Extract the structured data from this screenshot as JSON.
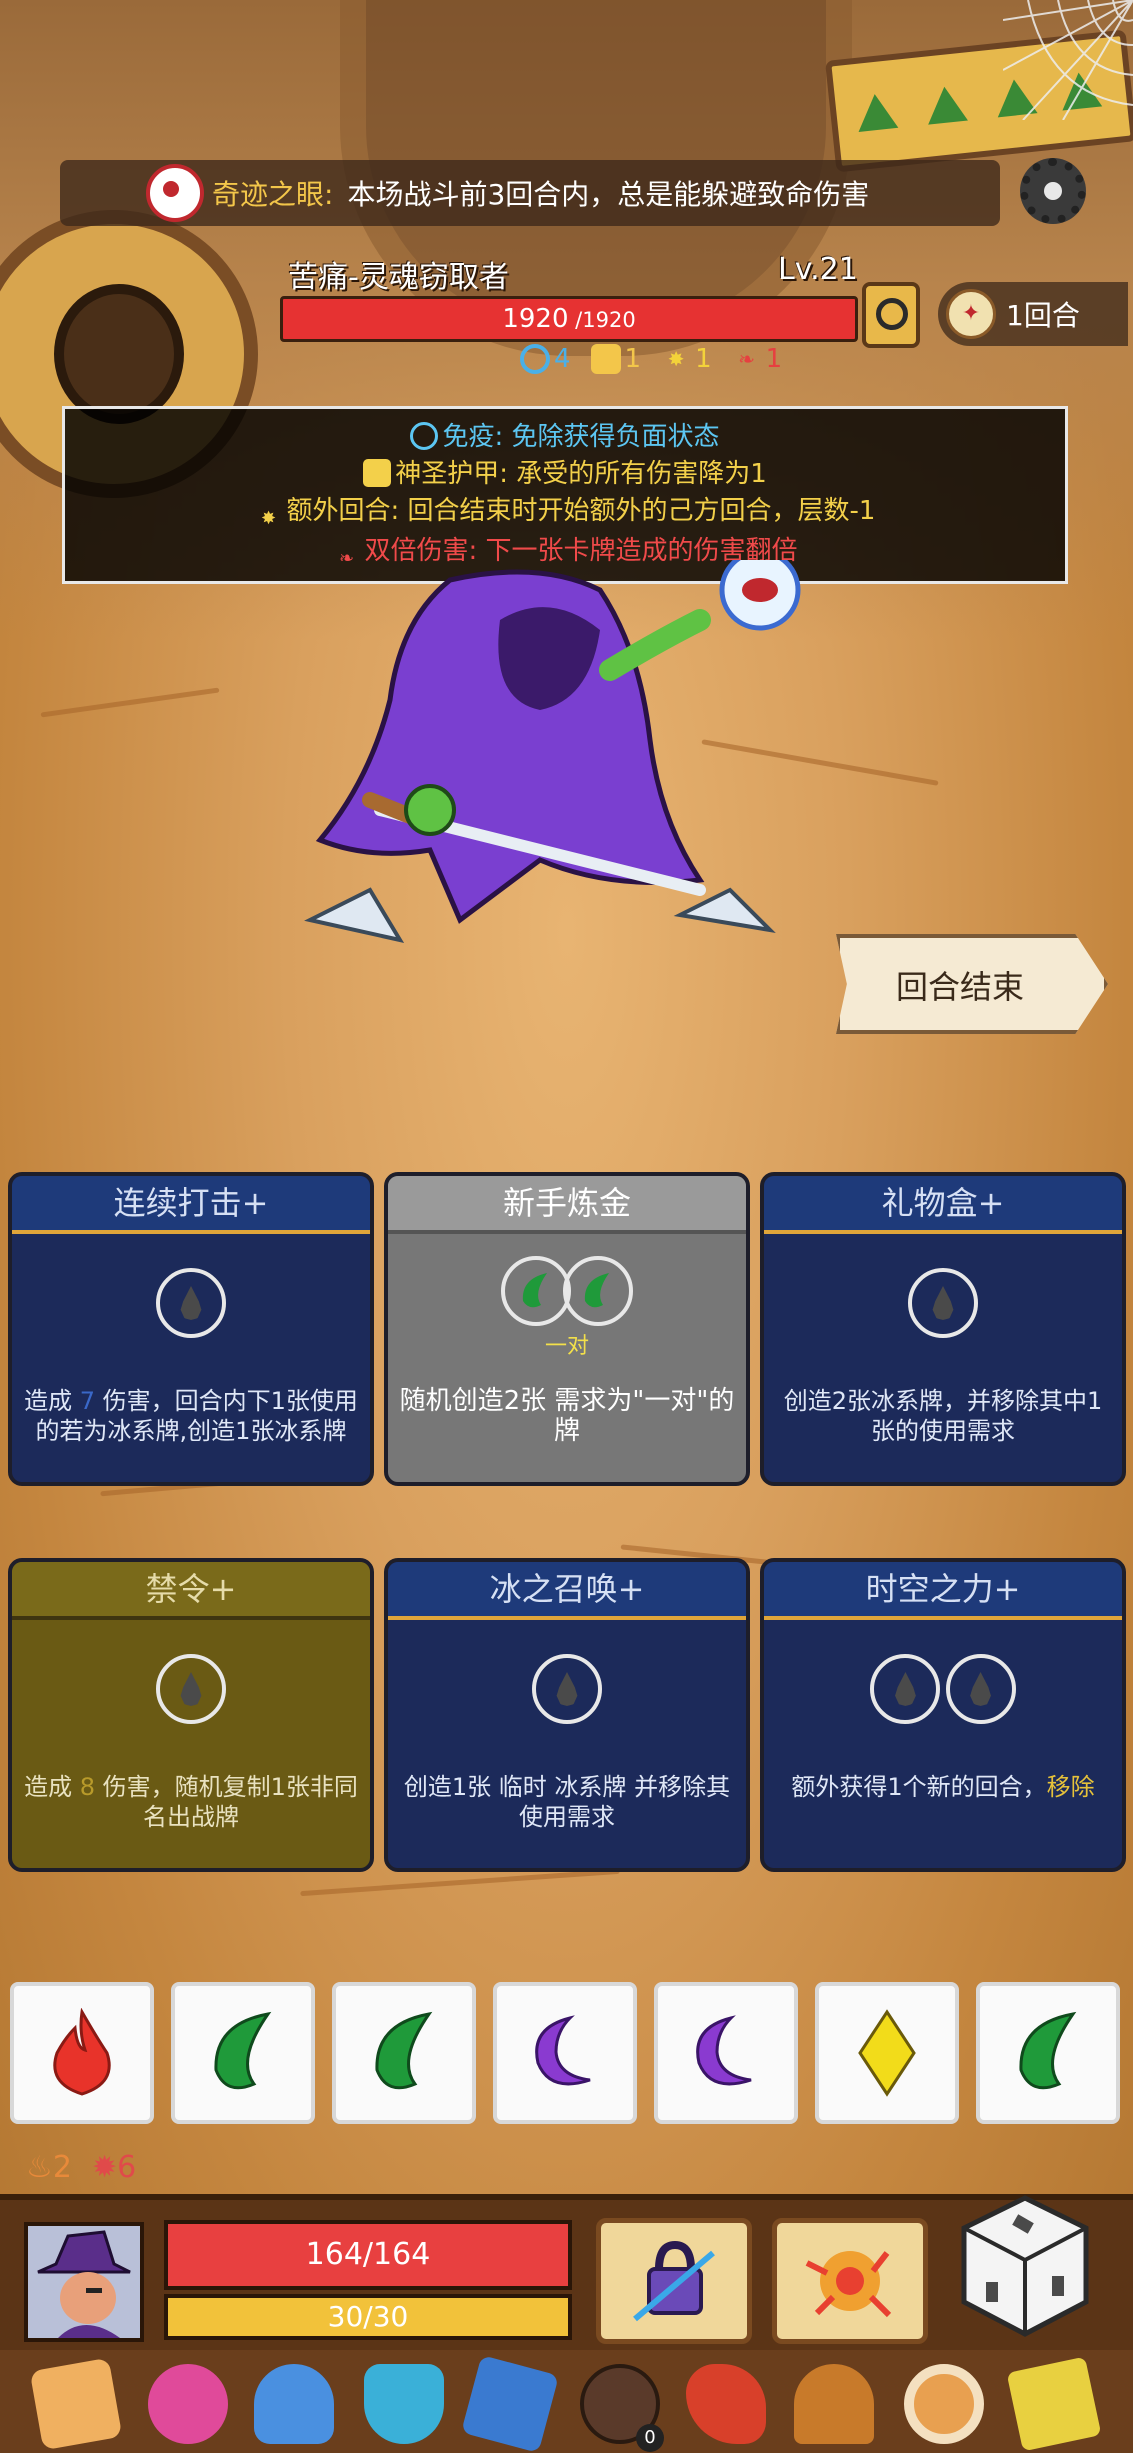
{
  "relic_banner": {
    "name": "奇迹之眼:",
    "description": "本场战斗前3回合内，总是能躲避致命伤害"
  },
  "enemy": {
    "name": "苦痛-灵魂窃取者",
    "level": "Lv.21",
    "hp_current": "1920",
    "hp_max": " /1920",
    "hp_fraction": 1.0,
    "turn_counter": "1回合",
    "statuses": [
      {
        "icon": "immunity-icon",
        "count": "4",
        "color": "#4ab0e8"
      },
      {
        "icon": "holy-armor-icon",
        "count": "1",
        "color": "#f3c64a"
      },
      {
        "icon": "extra-turn-icon",
        "count": "1",
        "color": "#f3d23a"
      },
      {
        "icon": "double-damage-icon",
        "count": "1",
        "color": "#e64040"
      }
    ]
  },
  "status_panel": [
    {
      "text": "免疫: 免除获得负面状态",
      "color": "#5cc6f2",
      "icon": "immunity-icon"
    },
    {
      "text": "神圣护甲: 承受的所有伤害降为1",
      "color": "#f3d04a",
      "icon": "holy-armor-icon"
    },
    {
      "text": "额外回合: 回合结束时开始额外的己方回合，层数-1",
      "color": "#f3d04a",
      "icon": "extra-turn-icon"
    },
    {
      "text": "双倍伤害: 下一张卡牌造成的伤害翻倍",
      "color": "#f04a4a",
      "icon": "double-damage-icon"
    }
  ],
  "end_turn_label": "回合结束",
  "cards": [
    {
      "title": "连续打击+",
      "style": "blue",
      "slots": 1,
      "desc_parts": [
        "造成 ",
        "7",
        " 伤害，回合内下1张使用的若为",
        "冰系牌,",
        "创造1张冰系牌"
      ]
    },
    {
      "title": "新手炼金",
      "style": "gray",
      "pair_label": "一对",
      "desc": "随机创造2张 需求为\"一对\"的牌"
    },
    {
      "title": "礼物盒+",
      "style": "blue",
      "slots": 1,
      "desc": "创造2张冰系牌，并移除其中1张的使用需求"
    },
    {
      "title": "禁令+",
      "style": "olive",
      "slots": 1,
      "desc_parts": [
        "造成 ",
        "8",
        " 伤害，随机复制1张非同名出战牌"
      ]
    },
    {
      "title": "冰之召唤+",
      "style": "blue",
      "slots": 1,
      "desc_parts": [
        "创造1张 临时 ",
        "冰系牌 并移除其使用需求"
      ]
    },
    {
      "title": "时空之力+",
      "style": "blue",
      "slots": 2,
      "desc_parts": [
        "额外获得1个新的回合，",
        "移除"
      ]
    }
  ],
  "dice": [
    {
      "icon": "fire-gem-icon",
      "color": "#e8332a"
    },
    {
      "icon": "leaf-gem-icon",
      "color": "#1f9a3a"
    },
    {
      "icon": "leaf-gem-icon",
      "color": "#1f9a3a"
    },
    {
      "icon": "moon-gem-icon",
      "color": "#8a3ad0"
    },
    {
      "icon": "moon-gem-icon",
      "color": "#8a3ad0"
    },
    {
      "icon": "diamond-gem-icon",
      "color": "#f2dc1a"
    },
    {
      "icon": "leaf-gem-icon",
      "color": "#1f9a3a"
    }
  ],
  "counters": [
    {
      "icon": "fire-counter-icon",
      "value": "2",
      "color": "#e88a3a"
    },
    {
      "icon": "burst-counter-icon",
      "value": "6",
      "color": "#e04a4a"
    }
  ],
  "player": {
    "hp": "164/164",
    "mana": "30/30"
  },
  "relic_strip_badge": "0",
  "colors": {
    "enemy_hp": "#e63232",
    "player_hp": "#e84040",
    "player_mana": "#f2c23a",
    "card_blue": "#1c2a5a",
    "card_olive": "#6a5a14",
    "card_gray": "#777777"
  }
}
